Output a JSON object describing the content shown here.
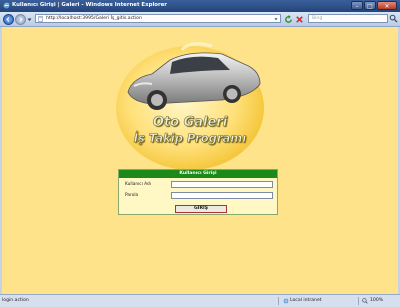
{
  "window": {
    "title": "Kullanıcı Girişi | Galeri - Windows Internet Explorer"
  },
  "address_bar": {
    "url": "http://localhost:3995/Galeri İş_gitis.action"
  },
  "search": {
    "placeholder": "Bing"
  },
  "logo": {
    "line1": "Oto Galeri",
    "line2": "İş Takip Programı"
  },
  "login": {
    "header": "Kullanıcı Girişi",
    "username_label": "Kullanıcı Adı",
    "username_value": "",
    "password_label": "Parola",
    "password_value": "",
    "button_label": "GİRİŞ"
  },
  "status": {
    "left_text": "login.action",
    "zone": "Local intranet",
    "zoom": "100%"
  },
  "colors": {
    "page_bg": "#ffe38a",
    "login_header": "#1c8a18",
    "titlebar": "#24457a"
  }
}
